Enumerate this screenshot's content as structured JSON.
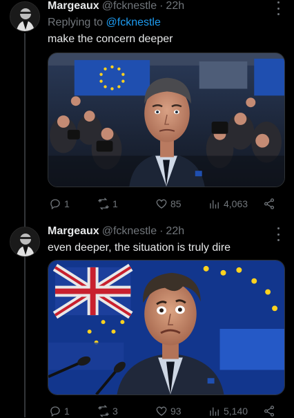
{
  "tweets": [
    {
      "name": "Margeaux",
      "handle": "@fcknestle",
      "dot": "·",
      "time": "22h",
      "reply_prefix": "Replying to",
      "reply_mention": "@fcknestle",
      "text": "make the concern deeper",
      "stats": {
        "replies": "1",
        "retweets": "1",
        "likes": "85",
        "views": "4,063"
      }
    },
    {
      "name": "Margeaux",
      "handle": "@fcknestle",
      "dot": "·",
      "time": "22h",
      "text": "even deeper, the situation is truly dire",
      "stats": {
        "replies": "1",
        "retweets": "3",
        "likes": "93",
        "views": "5,140"
      }
    }
  ],
  "colors": {
    "background": "#000000",
    "text": "#e7e9ea",
    "muted": "#71767b",
    "link": "#1d9bf0",
    "eu_blue": "#1f4fb0",
    "eu_gold": "#ffd21f"
  },
  "icons": [
    "reply-icon",
    "retweet-icon",
    "like-icon",
    "views-icon",
    "share-icon",
    "more-icon"
  ]
}
